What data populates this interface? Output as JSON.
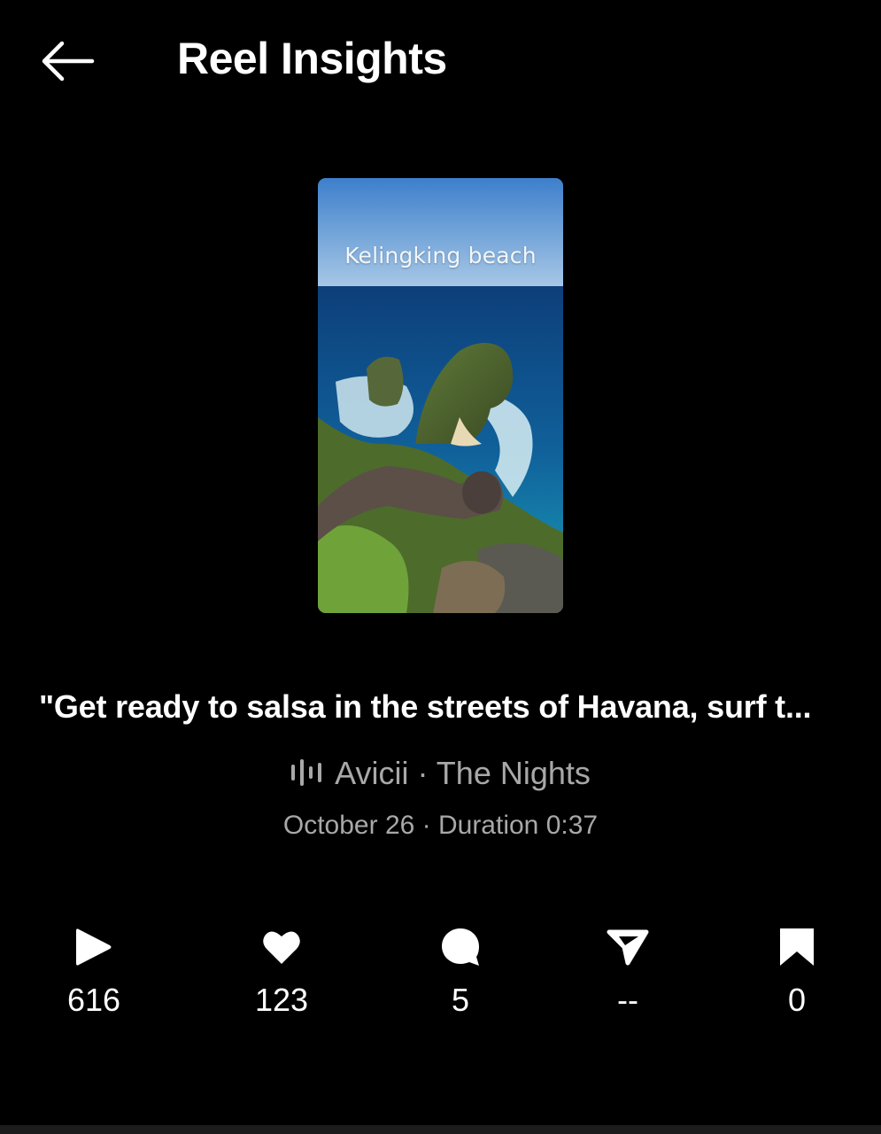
{
  "header": {
    "title": "Reel Insights",
    "back_icon": "arrow-left-icon"
  },
  "reel": {
    "thumbnail_caption": "Kelingking beach",
    "caption": "\"Get ready to salsa in the streets of Havana, surf t...",
    "audio": {
      "icon": "audio-wave-icon",
      "text": "Avicii · The Nights"
    },
    "meta": "October 26 · Duration 0:37"
  },
  "stats": [
    {
      "icon": "play-icon",
      "value": "616"
    },
    {
      "icon": "heart-icon",
      "value": "123"
    },
    {
      "icon": "comment-icon",
      "value": "5"
    },
    {
      "icon": "share-icon",
      "value": "--"
    },
    {
      "icon": "bookmark-icon",
      "value": "0"
    }
  ],
  "colors": {
    "background": "#000000",
    "text_primary": "#ffffff",
    "text_secondary": "#a8a8a8"
  }
}
